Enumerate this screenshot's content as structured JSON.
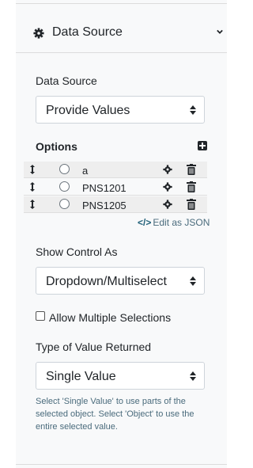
{
  "header": {
    "title": "Data Source"
  },
  "data_source": {
    "label": "Data Source",
    "selected": "Provide Values"
  },
  "options": {
    "heading": "Options",
    "items": [
      {
        "label": "a"
      },
      {
        "label": "PNS1201"
      },
      {
        "label": "PNS1205"
      }
    ],
    "edit_json_label": "Edit as JSON"
  },
  "show_control": {
    "label": "Show Control As",
    "selected": "Dropdown/Multiselect"
  },
  "allow_multiple": {
    "label": "Allow Multiple Selections",
    "checked": false
  },
  "value_type": {
    "label": "Type of Value Returned",
    "selected": "Single Value",
    "help": "Select 'Single Value' to use parts of the selected object. Select 'Object' to use the entire selected value."
  }
}
